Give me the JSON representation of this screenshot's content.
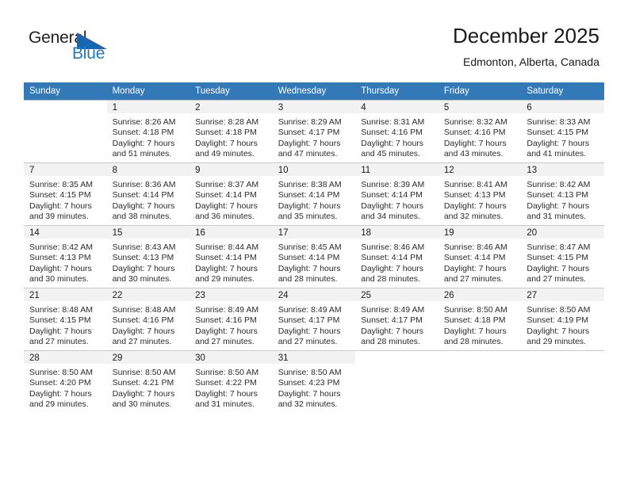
{
  "brand": {
    "name_part1": "General",
    "name_part2": "Blue",
    "triangle_color": "#1668b3",
    "blue_color": "#1e7ac4"
  },
  "header": {
    "title": "December 2025",
    "subtitle": "Edmonton, Alberta, Canada"
  },
  "theme": {
    "header_row_bg": "#3379b8",
    "daynum_bg": "#f2f2f2",
    "grid_line": "#c9c9c9"
  },
  "weekday_headers": [
    "Sunday",
    "Monday",
    "Tuesday",
    "Wednesday",
    "Thursday",
    "Friday",
    "Saturday"
  ],
  "labels": {
    "sunrise_prefix": "Sunrise: ",
    "sunset_prefix": "Sunset: ",
    "daylight_prefix": "Daylight: "
  },
  "weeks": [
    [
      {
        "day": "",
        "l1": "",
        "l2": "",
        "l3": "",
        "l4": "",
        "blank": true
      },
      {
        "day": "1",
        "l1": "Sunrise: 8:26 AM",
        "l2": "Sunset: 4:18 PM",
        "l3": "Daylight: 7 hours",
        "l4": "and 51 minutes."
      },
      {
        "day": "2",
        "l1": "Sunrise: 8:28 AM",
        "l2": "Sunset: 4:18 PM",
        "l3": "Daylight: 7 hours",
        "l4": "and 49 minutes."
      },
      {
        "day": "3",
        "l1": "Sunrise: 8:29 AM",
        "l2": "Sunset: 4:17 PM",
        "l3": "Daylight: 7 hours",
        "l4": "and 47 minutes."
      },
      {
        "day": "4",
        "l1": "Sunrise: 8:31 AM",
        "l2": "Sunset: 4:16 PM",
        "l3": "Daylight: 7 hours",
        "l4": "and 45 minutes."
      },
      {
        "day": "5",
        "l1": "Sunrise: 8:32 AM",
        "l2": "Sunset: 4:16 PM",
        "l3": "Daylight: 7 hours",
        "l4": "and 43 minutes."
      },
      {
        "day": "6",
        "l1": "Sunrise: 8:33 AM",
        "l2": "Sunset: 4:15 PM",
        "l3": "Daylight: 7 hours",
        "l4": "and 41 minutes."
      }
    ],
    [
      {
        "day": "7",
        "l1": "Sunrise: 8:35 AM",
        "l2": "Sunset: 4:15 PM",
        "l3": "Daylight: 7 hours",
        "l4": "and 39 minutes."
      },
      {
        "day": "8",
        "l1": "Sunrise: 8:36 AM",
        "l2": "Sunset: 4:14 PM",
        "l3": "Daylight: 7 hours",
        "l4": "and 38 minutes."
      },
      {
        "day": "9",
        "l1": "Sunrise: 8:37 AM",
        "l2": "Sunset: 4:14 PM",
        "l3": "Daylight: 7 hours",
        "l4": "and 36 minutes."
      },
      {
        "day": "10",
        "l1": "Sunrise: 8:38 AM",
        "l2": "Sunset: 4:14 PM",
        "l3": "Daylight: 7 hours",
        "l4": "and 35 minutes."
      },
      {
        "day": "11",
        "l1": "Sunrise: 8:39 AM",
        "l2": "Sunset: 4:14 PM",
        "l3": "Daylight: 7 hours",
        "l4": "and 34 minutes."
      },
      {
        "day": "12",
        "l1": "Sunrise: 8:41 AM",
        "l2": "Sunset: 4:13 PM",
        "l3": "Daylight: 7 hours",
        "l4": "and 32 minutes."
      },
      {
        "day": "13",
        "l1": "Sunrise: 8:42 AM",
        "l2": "Sunset: 4:13 PM",
        "l3": "Daylight: 7 hours",
        "l4": "and 31 minutes."
      }
    ],
    [
      {
        "day": "14",
        "l1": "Sunrise: 8:42 AM",
        "l2": "Sunset: 4:13 PM",
        "l3": "Daylight: 7 hours",
        "l4": "and 30 minutes."
      },
      {
        "day": "15",
        "l1": "Sunrise: 8:43 AM",
        "l2": "Sunset: 4:13 PM",
        "l3": "Daylight: 7 hours",
        "l4": "and 30 minutes."
      },
      {
        "day": "16",
        "l1": "Sunrise: 8:44 AM",
        "l2": "Sunset: 4:14 PM",
        "l3": "Daylight: 7 hours",
        "l4": "and 29 minutes."
      },
      {
        "day": "17",
        "l1": "Sunrise: 8:45 AM",
        "l2": "Sunset: 4:14 PM",
        "l3": "Daylight: 7 hours",
        "l4": "and 28 minutes."
      },
      {
        "day": "18",
        "l1": "Sunrise: 8:46 AM",
        "l2": "Sunset: 4:14 PM",
        "l3": "Daylight: 7 hours",
        "l4": "and 28 minutes."
      },
      {
        "day": "19",
        "l1": "Sunrise: 8:46 AM",
        "l2": "Sunset: 4:14 PM",
        "l3": "Daylight: 7 hours",
        "l4": "and 27 minutes."
      },
      {
        "day": "20",
        "l1": "Sunrise: 8:47 AM",
        "l2": "Sunset: 4:15 PM",
        "l3": "Daylight: 7 hours",
        "l4": "and 27 minutes."
      }
    ],
    [
      {
        "day": "21",
        "l1": "Sunrise: 8:48 AM",
        "l2": "Sunset: 4:15 PM",
        "l3": "Daylight: 7 hours",
        "l4": "and 27 minutes."
      },
      {
        "day": "22",
        "l1": "Sunrise: 8:48 AM",
        "l2": "Sunset: 4:16 PM",
        "l3": "Daylight: 7 hours",
        "l4": "and 27 minutes."
      },
      {
        "day": "23",
        "l1": "Sunrise: 8:49 AM",
        "l2": "Sunset: 4:16 PM",
        "l3": "Daylight: 7 hours",
        "l4": "and 27 minutes."
      },
      {
        "day": "24",
        "l1": "Sunrise: 8:49 AM",
        "l2": "Sunset: 4:17 PM",
        "l3": "Daylight: 7 hours",
        "l4": "and 27 minutes."
      },
      {
        "day": "25",
        "l1": "Sunrise: 8:49 AM",
        "l2": "Sunset: 4:17 PM",
        "l3": "Daylight: 7 hours",
        "l4": "and 28 minutes."
      },
      {
        "day": "26",
        "l1": "Sunrise: 8:50 AM",
        "l2": "Sunset: 4:18 PM",
        "l3": "Daylight: 7 hours",
        "l4": "and 28 minutes."
      },
      {
        "day": "27",
        "l1": "Sunrise: 8:50 AM",
        "l2": "Sunset: 4:19 PM",
        "l3": "Daylight: 7 hours",
        "l4": "and 29 minutes."
      }
    ],
    [
      {
        "day": "28",
        "l1": "Sunrise: 8:50 AM",
        "l2": "Sunset: 4:20 PM",
        "l3": "Daylight: 7 hours",
        "l4": "and 29 minutes."
      },
      {
        "day": "29",
        "l1": "Sunrise: 8:50 AM",
        "l2": "Sunset: 4:21 PM",
        "l3": "Daylight: 7 hours",
        "l4": "and 30 minutes."
      },
      {
        "day": "30",
        "l1": "Sunrise: 8:50 AM",
        "l2": "Sunset: 4:22 PM",
        "l3": "Daylight: 7 hours",
        "l4": "and 31 minutes."
      },
      {
        "day": "31",
        "l1": "Sunrise: 8:50 AM",
        "l2": "Sunset: 4:23 PM",
        "l3": "Daylight: 7 hours",
        "l4": "and 32 minutes."
      },
      {
        "day": "",
        "l1": "",
        "l2": "",
        "l3": "",
        "l4": "",
        "blank": true
      },
      {
        "day": "",
        "l1": "",
        "l2": "",
        "l3": "",
        "l4": "",
        "blank": true
      },
      {
        "day": "",
        "l1": "",
        "l2": "",
        "l3": "",
        "l4": "",
        "blank": true
      }
    ]
  ]
}
